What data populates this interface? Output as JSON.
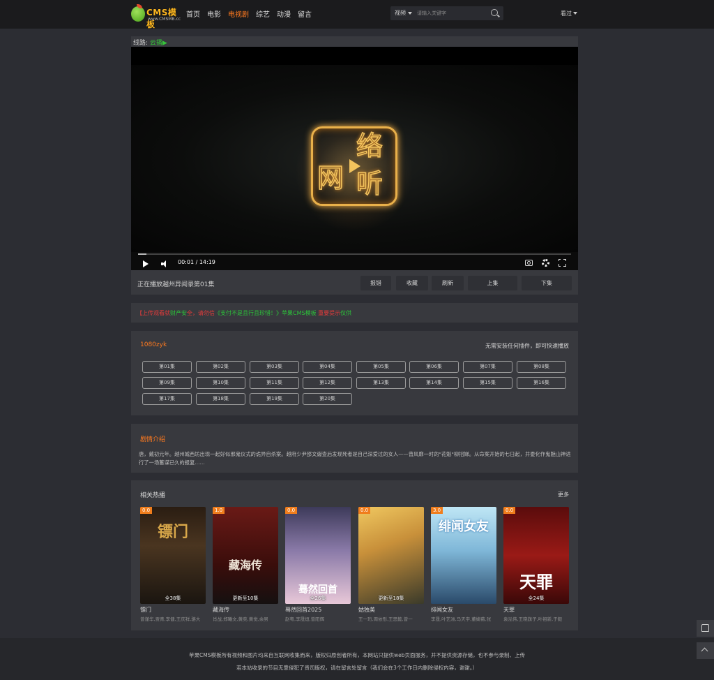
{
  "header": {
    "logo_text": "CMS模板",
    "logo_sub": "www.CMSMB.cc",
    "nav": [
      "首页",
      "电影",
      "电视剧",
      "综艺",
      "动漫",
      "留言"
    ],
    "active_nav": "电视剧",
    "search_category": "视频",
    "search_placeholder": "请输入关键字",
    "history_label": "看过"
  },
  "player": {
    "route_label": "线路:",
    "route_source": "云播▶",
    "time": "00:01 / 14:19",
    "progress": 0.0012,
    "now_playing": "正在播放越州异闻录第01集",
    "buttons": [
      "报错",
      "收藏",
      "刷新",
      "上集",
      "下集"
    ]
  },
  "notice": {
    "p1": "【上传观看就",
    "p2": "财产安",
    "p3": "全，请勿信",
    "p4": "《支付不是且行且珍惜！》",
    "p5": "苹果CMS模板 ",
    "p6": "重要提示",
    "p7": "仅供"
  },
  "episodes": {
    "source_title": "1080zyk",
    "hint": "无需安装任何插件，即可快速播放",
    "items": [
      "第01集",
      "第02集",
      "第03集",
      "第04集",
      "第05集",
      "第06集",
      "第07集",
      "第08集",
      "第09集",
      "第10集",
      "第11集",
      "第12集",
      "第13集",
      "第14集",
      "第15集",
      "第16集",
      "第17集",
      "第18集",
      "第19集",
      "第20集"
    ]
  },
  "synopsis": {
    "title": "剧情介绍",
    "text": "唐，戴初元年。越州城西坊出现一起好似邪鬼仪式的诡异自杀案。越府少尹邵文谳查后发现死者是自己深爱过的女人——曾风靡一时的\"花魁\"柳招娣。从命案开始的七日起，井娄化作鬼魅山神进行了一场蓄谋已久的报复……"
  },
  "related": {
    "title": "相关热播",
    "more": "更多",
    "items": [
      {
        "name": "镖门",
        "actors": "曾谨华,贾青,李健,王庆祥,骆大",
        "score": "0.0",
        "status": "全38集",
        "poster_title": "镖门"
      },
      {
        "name": "藏海传",
        "actors": "肖战,郑曦文,黄奕,黄觉,余男",
        "score": "1.0",
        "status": "更新至10集",
        "poster_title": "藏海传"
      },
      {
        "name": "蓦然回首2025",
        "actors": "赵粤,李晟烜,曾阳辉",
        "score": "0.0",
        "status": "全26集",
        "poster_title": "蓦然回首"
      },
      {
        "name": "姑独美",
        "actors": "王一珩,周依彤,王思懿,曾一",
        "score": "0.0",
        "status": "更新至18集",
        "poster_title": ""
      },
      {
        "name": "绯闻女友",
        "actors": "李晟,叶艺洲,马天宇,董婕薇,张",
        "score": "3.0",
        "status": "",
        "poster_title": "绯闻女友"
      },
      {
        "name": "天罪",
        "actors": "袁泓伟,王晓旗子,叶祖新,于毅",
        "score": "0.0",
        "status": "全24集",
        "poster_title": "天罪"
      }
    ]
  },
  "footer": {
    "line1": "苹果CMS模板所有视频和图片均来自互联网收集而来，版权归原创者所有，本网站只提供web页面服务，并不提供资源存储，也不参与录制、上传",
    "line2": "若本站收录的节目无意侵犯了贵司版权，请在留言处留言（我们会在3个工作日内删除侵权内容，谢谢。）"
  }
}
